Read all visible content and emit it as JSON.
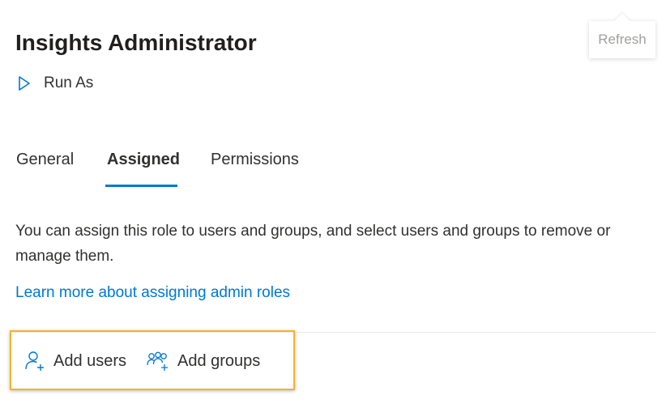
{
  "header": {
    "title": "Insights Administrator",
    "run_as_label": "Run As",
    "refresh_label": "Refresh"
  },
  "tabs": [
    {
      "label": "General",
      "active": false
    },
    {
      "label": "Assigned",
      "active": true
    },
    {
      "label": "Permissions",
      "active": false
    }
  ],
  "content": {
    "description": "You can assign this role to users and groups, and select users and groups to remove or manage them.",
    "learn_more_link": "Learn more about assigning admin roles"
  },
  "actions": {
    "add_users_label": "Add users",
    "add_groups_label": "Add groups"
  },
  "colors": {
    "accent": "#0078d4",
    "highlight_border": "#f2b52a",
    "text": "#323130",
    "muted": "#a19f9d"
  },
  "icons": {
    "run_as": "play-icon",
    "add_users": "add-user-icon",
    "add_groups": "add-group-icon"
  }
}
